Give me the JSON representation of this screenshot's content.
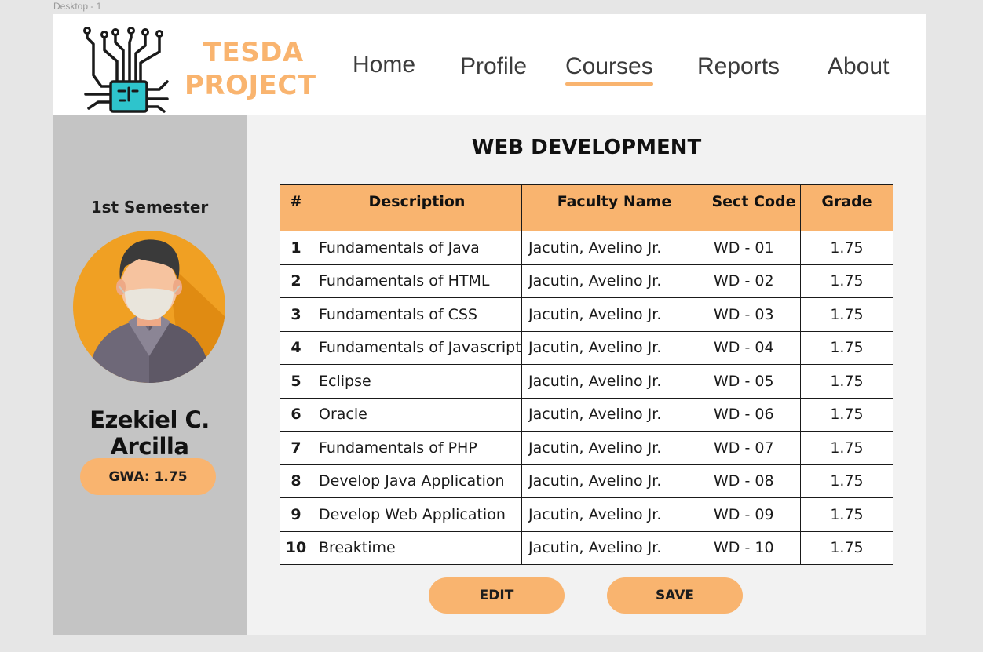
{
  "canvas_label": "Desktop - 1",
  "brand": {
    "line1": "TESDA",
    "line2": "PROJECT",
    "color": "#f9b46f"
  },
  "nav": [
    {
      "label": "Home",
      "active": false
    },
    {
      "label": "Profile",
      "active": false
    },
    {
      "label": "Courses",
      "active": true
    },
    {
      "label": "Reports",
      "active": false
    },
    {
      "label": "About",
      "active": false
    }
  ],
  "sidebar": {
    "semester": "1st Semester",
    "student_name": "Ezekiel C. Arcilla",
    "gwa": "GWA: 1.75"
  },
  "course": {
    "title": "WEB DEVELOPMENT",
    "headers": [
      "#",
      "Description",
      "Faculty Name",
      "Sect Code",
      "Grade"
    ],
    "rows": [
      {
        "num": "1",
        "description": "Fundamentals of Java",
        "faculty": "Jacutin, Avelino Jr.",
        "sect": "WD - 01",
        "grade": "1.75"
      },
      {
        "num": "2",
        "description": "Fundamentals of HTML",
        "faculty": "Jacutin, Avelino Jr.",
        "sect": "WD - 02",
        "grade": "1.75"
      },
      {
        "num": "3",
        "description": "Fundamentals of CSS",
        "faculty": "Jacutin, Avelino Jr.",
        "sect": "WD - 03",
        "grade": "1.75"
      },
      {
        "num": "4",
        "description": "Fundamentals of Javascript",
        "faculty": "Jacutin, Avelino Jr.",
        "sect": "WD - 04",
        "grade": "1.75"
      },
      {
        "num": "5",
        "description": "Eclipse",
        "faculty": "Jacutin, Avelino Jr.",
        "sect": "WD - 05",
        "grade": "1.75"
      },
      {
        "num": "6",
        "description": "Oracle",
        "faculty": "Jacutin, Avelino Jr.",
        "sect": "WD - 06",
        "grade": "1.75"
      },
      {
        "num": "7",
        "description": "Fundamentals of PHP",
        "faculty": "Jacutin, Avelino Jr.",
        "sect": "WD - 07",
        "grade": "1.75"
      },
      {
        "num": "8",
        "description": "Develop Java Application",
        "faculty": "Jacutin, Avelino Jr.",
        "sect": "WD - 08",
        "grade": "1.75"
      },
      {
        "num": "9",
        "description": "Develop Web Application",
        "faculty": "Jacutin, Avelino Jr.",
        "sect": "WD - 09",
        "grade": "1.75"
      },
      {
        "num": "10",
        "description": "Breaktime",
        "faculty": "Jacutin, Avelino Jr.",
        "sect": "WD - 10",
        "grade": "1.75"
      }
    ]
  },
  "actions": {
    "edit": "EDIT",
    "save": "SAVE"
  },
  "colors": {
    "accent": "#f9b46f",
    "sidebar": "#c4c4c4",
    "logo_chip": "#2ec4cc"
  },
  "icons": {
    "logo": "circuit-chip-icon",
    "avatar": "masked-person-avatar"
  }
}
